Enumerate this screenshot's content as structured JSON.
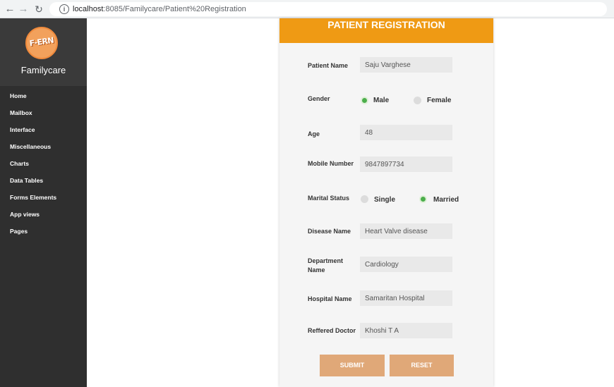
{
  "browser": {
    "url_host": "localhost",
    "url_rest": ":8085/Familycare/Patient%20Registration"
  },
  "sidebar": {
    "logo_text": "F-ERN",
    "brand": "Familycare",
    "items": [
      {
        "label": "Home"
      },
      {
        "label": "Mailbox"
      },
      {
        "label": "Interface"
      },
      {
        "label": "Miscellaneous"
      },
      {
        "label": "Charts"
      },
      {
        "label": "Data Tables"
      },
      {
        "label": "Forms Elements"
      },
      {
        "label": "App views"
      },
      {
        "label": "Pages"
      }
    ]
  },
  "form": {
    "title": "PATIENT REGISTRATION",
    "patient_name": {
      "label": "Patient Name",
      "value": "Saju Varghese"
    },
    "gender": {
      "label": "Gender",
      "options": [
        "Male",
        "Female"
      ],
      "selected": "Male"
    },
    "age": {
      "label": "Age",
      "value": "48"
    },
    "mobile": {
      "label": "Mobile Number",
      "value": "9847897734"
    },
    "marital_status": {
      "label": "Marital Status",
      "options": [
        "Single",
        "Married"
      ],
      "selected": "Married"
    },
    "disease": {
      "label": "Disease Name",
      "value": "Heart Valve disease"
    },
    "department": {
      "label": "Department Name",
      "value": "Cardiology"
    },
    "hospital": {
      "label": "Hospital Name",
      "value": "Samaritan Hospital"
    },
    "doctor": {
      "label": "Reffered Doctor",
      "value": "Khoshi T A"
    },
    "submit_label": "SUBMIT",
    "reset_label": "RESET"
  }
}
